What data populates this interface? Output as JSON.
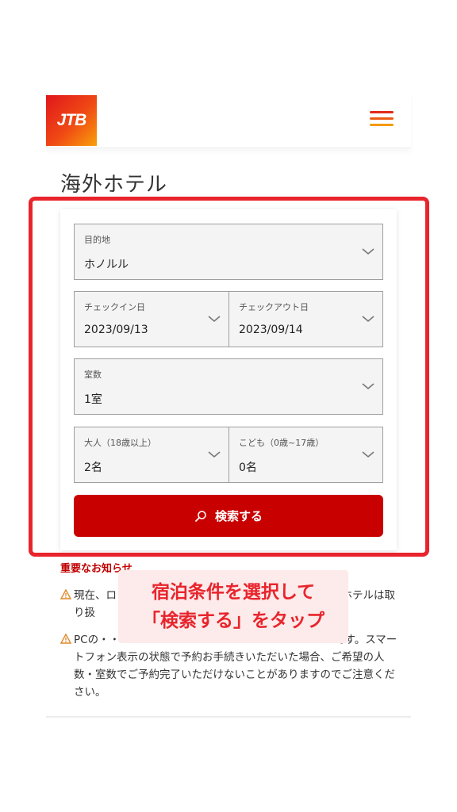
{
  "header": {
    "logo_text": "JTB",
    "menu_icon": "hamburger-menu-icon"
  },
  "page_title": "海外ホテル",
  "form": {
    "destination": {
      "label": "目的地",
      "value": "ホノルル"
    },
    "checkin": {
      "label": "チェックイン日",
      "value": "2023/09/13"
    },
    "checkout": {
      "label": "チェックアウト日",
      "value": "2023/09/14"
    },
    "rooms": {
      "label": "室数",
      "value": "1室"
    },
    "adults": {
      "label": "大人（18歳以上）",
      "value": "2名"
    },
    "children": {
      "label": "こども（0歳~17歳）",
      "value": "0名"
    },
    "search_label": "検索する"
  },
  "notices": {
    "title": "重要なお知らせ",
    "item1": "現在、ロ・・・・・・・・・・・・・・・・・・・・・ホテルは取り扱",
    "item2": "PCの・・・・・・・・・・・・・・・・・・・・・・です。スマートフォン表示の状態で予約お手続きいただいた場合、ご希望の人数・室数でご予約完了いただけないことがありますのでご注意ください。"
  },
  "annotation": {
    "line1": "宿泊条件を選択して",
    "line2": "「検索する」をタップ"
  },
  "colors": {
    "accent": "#c80000",
    "highlight": "#e8242c",
    "callout_bg": "#fdeaea"
  }
}
